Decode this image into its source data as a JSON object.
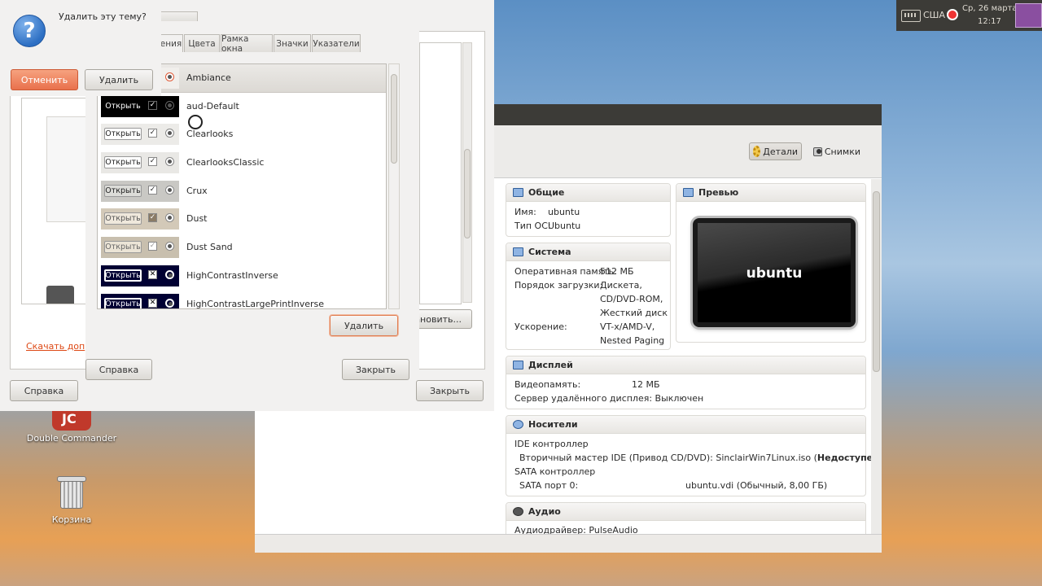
{
  "top_panel": {
    "keyboard_layout": "США",
    "date": "Ср, 26 марта",
    "time": "12:17"
  },
  "desktop": {
    "icons": [
      {
        "label": "Double Commander",
        "icon": "double-commander-icon"
      },
      {
        "label": "Корзина",
        "icon": "trash-icon"
      }
    ]
  },
  "back_window": {
    "cancel_label": "Отменить",
    "delete_label": "Удалить",
    "download_link": "Скачать доп",
    "install_label": "тановить...",
    "help_label": "Справка",
    "close_label": "Закрыть"
  },
  "confirm_dialog": {
    "question": "Удалить эту тему?",
    "icon": "question-icon"
  },
  "appearance_dialog": {
    "tabs": [
      "ения",
      "Цвета",
      "Рамка окна",
      "Значки",
      "Указатели"
    ],
    "themes": [
      {
        "name": "Ambiance",
        "open_label": "",
        "selected": true
      },
      {
        "name": "aud-Default",
        "open_label": "Открыть"
      },
      {
        "name": "Clearlooks",
        "open_label": "Открыть"
      },
      {
        "name": "ClearlooksClassic",
        "open_label": "Открыть"
      },
      {
        "name": "Crux",
        "open_label": "Открыть"
      },
      {
        "name": "Dust",
        "open_label": "Открыть"
      },
      {
        "name": "Dust Sand",
        "open_label": "Открыть"
      },
      {
        "name": "HighContrastInverse",
        "open_label": "Открыть"
      },
      {
        "name": "HighContrastLargePrintInverse",
        "open_label": "Открыть"
      }
    ],
    "delete_label": "Удалить",
    "help_label": "Справка",
    "close_label": "Закрыть"
  },
  "vbox": {
    "toolbar": {
      "details_label": "Детали",
      "snapshots_label": "Снимки"
    },
    "general": {
      "title": "Общие",
      "name_label": "Имя:",
      "name_value": "ubuntu",
      "os_label": "Тип ОС:",
      "os_value": "Ubuntu"
    },
    "preview": {
      "title": "Превью",
      "screen_label": "ubuntu"
    },
    "system": {
      "title": "Система",
      "ram_label": "Оперативная память:",
      "ram_value": "512 МБ",
      "boot_label": "Порядок загрузки:",
      "boot_values": [
        "Дискета,",
        "CD/DVD-ROM,",
        "Жесткий диск"
      ],
      "accel_label": "Ускорение:",
      "accel_values": [
        "VT-x/AMD-V,",
        "Nested Paging"
      ]
    },
    "display": {
      "title": "Дисплей",
      "vram_label": "Видеопамять:",
      "vram_value": "12 МБ",
      "rdp_label": "Сервер удалённого дисплея: Выключен"
    },
    "storage": {
      "title": "Носители",
      "ide_controller": "IDE контроллер",
      "ide_device": "Вторичный мастер IDE (Привод CD/DVD): SinclairWin7Linux.iso (",
      "ide_status": "Недоступен",
      "ide_close": ")",
      "sata_controller": "SATA контроллер",
      "sata_port": "SATA порт 0:",
      "sata_value": "ubuntu.vdi (Обычный, 8,00 ГБ)"
    },
    "audio": {
      "title": "Аудио",
      "driver_label": "Аудиодрайвер: PulseAudio"
    }
  }
}
